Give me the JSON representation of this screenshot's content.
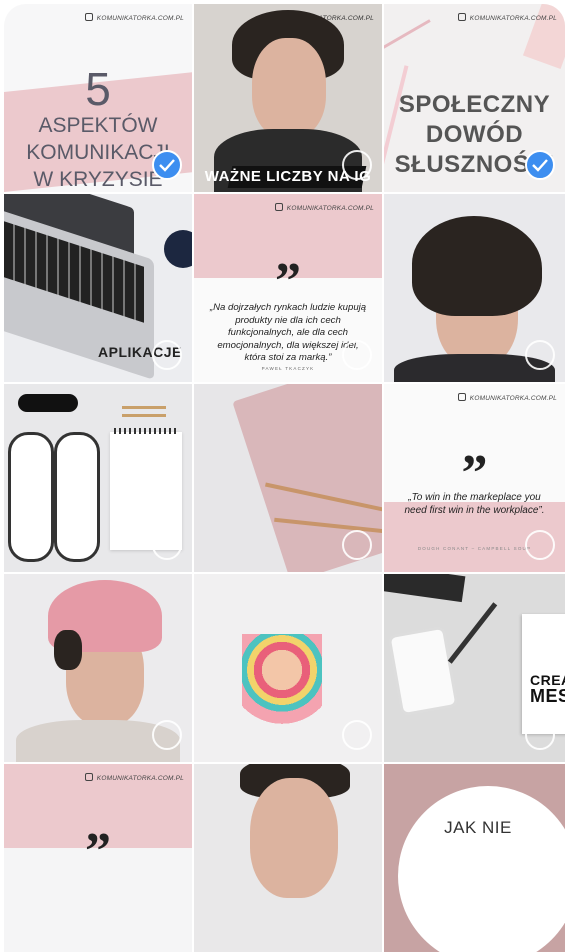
{
  "brand": "KOMUNIKATORKA.COM.PL",
  "tiles": [
    {
      "id": "t1",
      "selected": true,
      "number": "5",
      "lines": [
        "ASPEKTÓW",
        "KOMUNIKACJI",
        "W KRYZYSIE"
      ]
    },
    {
      "id": "t2",
      "selected": false,
      "caption": "WAŻNE LICZBY NA IG"
    },
    {
      "id": "t3",
      "selected": true,
      "lines": [
        "SPOŁECZNY",
        "DOWÓD",
        "SŁUSZNOŚCI"
      ]
    },
    {
      "id": "t4",
      "selected": false,
      "caption": "APLIKACJE"
    },
    {
      "id": "t5",
      "selected": false,
      "quote": "„Na dojrzałych rynkach ludzie kupują produkty nie dla ich cech funkcjonalnych, ale dla cech emocjonalnych, dla większej idei, która stoi za marką.”",
      "author": "PAWEŁ TKACZYK"
    },
    {
      "id": "t6",
      "selected": false
    },
    {
      "id": "t7",
      "selected": false
    },
    {
      "id": "t8",
      "selected": false
    },
    {
      "id": "t9",
      "selected": false,
      "quote": "„To win in the markeplace you need first win in the workplace”.",
      "author": "DOUGH CONANT – CAMPBELL SOUP"
    },
    {
      "id": "t10",
      "selected": false
    },
    {
      "id": "t11",
      "selected": false
    },
    {
      "id": "t12",
      "selected": false,
      "partial": [
        "CREAT",
        "MES"
      ]
    },
    {
      "id": "t13",
      "selected": false
    },
    {
      "id": "t14",
      "selected": false
    },
    {
      "id": "t15",
      "selected": false,
      "caption": "JAK NIE"
    }
  ],
  "colors": {
    "pink": "#ecc9cd",
    "check": "#3d8ef0",
    "text": "#5a5a68"
  }
}
